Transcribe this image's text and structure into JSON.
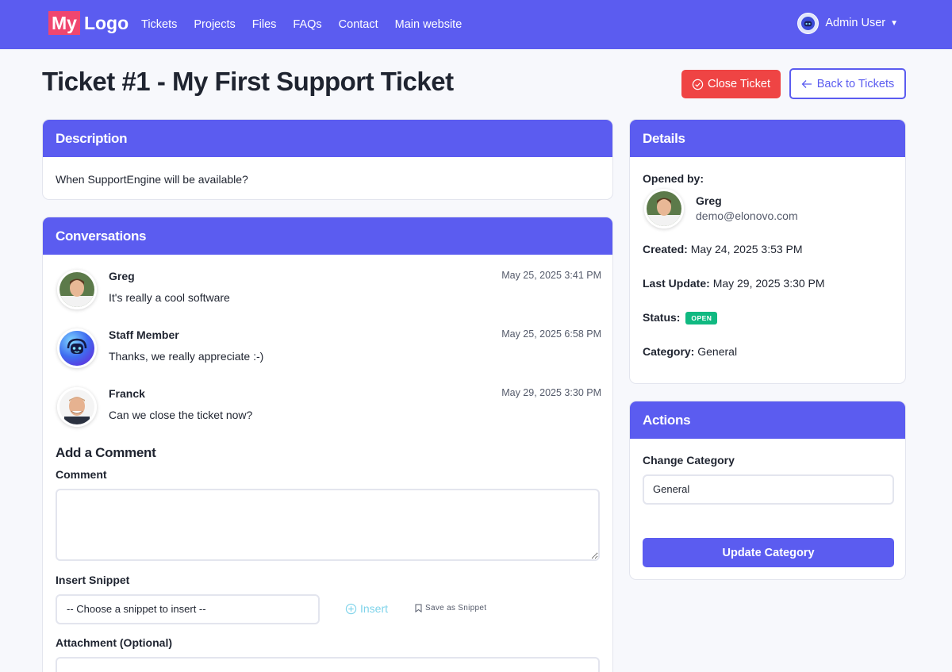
{
  "nav": {
    "logo_my": "My",
    "logo_logo": "Logo",
    "links": [
      "Tickets",
      "Projects",
      "Files",
      "FAQs",
      "Contact",
      "Main website"
    ],
    "user_name": "Admin User"
  },
  "header": {
    "title": "Ticket #1 - My First Support Ticket",
    "close_label": "Close Ticket",
    "back_label": "Back to Tickets"
  },
  "description": {
    "title": "Description",
    "text": "When SupportEngine will be available?"
  },
  "conversations": {
    "title": "Conversations",
    "items": [
      {
        "author": "Greg",
        "time": "May 25, 2025 3:41 PM",
        "text": "It's really a cool software"
      },
      {
        "author": "Staff Member",
        "time": "May 25, 2025 6:58 PM",
        "text": "Thanks, we really appreciate :-)"
      },
      {
        "author": "Franck",
        "time": "May 29, 2025 3:30 PM",
        "text": "Can we close the ticket now?"
      }
    ]
  },
  "comment_form": {
    "heading": "Add a Comment",
    "comment_label": "Comment",
    "comment_value": "",
    "snippet_label": "Insert Snippet",
    "snippet_placeholder": "-- Choose a snippet to insert --",
    "insert_label": "Insert",
    "save_snippet_label": "Save as Snippet",
    "attachment_label": "Attachment (Optional)"
  },
  "details": {
    "title": "Details",
    "opened_by_label": "Opened by:",
    "opener_name": "Greg",
    "opener_email": "demo@elonovo.com",
    "created_label": "Created:",
    "created_value": "May 24, 2025 3:53 PM",
    "updated_label": "Last Update:",
    "updated_value": "May 29, 2025 3:30 PM",
    "status_label": "Status:",
    "status_value": "OPEN",
    "category_label": "Category:",
    "category_value": "General"
  },
  "actions": {
    "title": "Actions",
    "change_category_label": "Change Category",
    "category_selected": "General",
    "update_label": "Update Category"
  },
  "colors": {
    "primary": "#5b5cf0",
    "danger": "#ef4444",
    "success": "#10b981",
    "logo_accent": "#f0466f"
  }
}
